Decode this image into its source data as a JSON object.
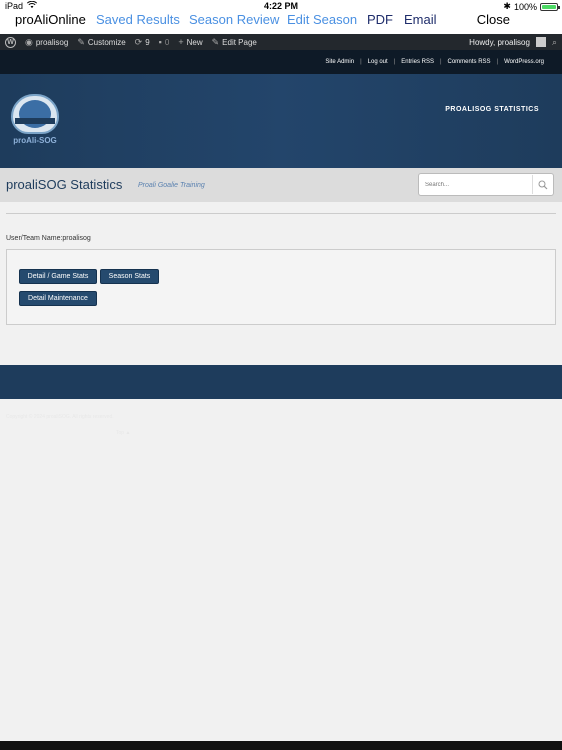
{
  "status_bar": {
    "device": "iPad",
    "time": "4:22 PM",
    "battery_percent": "100%",
    "battery_level": 1.0
  },
  "app_nav": {
    "title": "proAliOnline",
    "links": [
      "Saved Results",
      "Season Review",
      "Edit Season",
      "PDF",
      "Email"
    ],
    "close_label": "Close"
  },
  "wp_admin": {
    "site": "proalisog",
    "customize": "Customize",
    "updates": "9",
    "comments": "0",
    "new": "New",
    "edit_page": "Edit Page",
    "greeting": "Howdy, proalisog"
  },
  "top_links": [
    "Site Admin",
    "Log out",
    "Entries RSS",
    "Comments RSS",
    "WordPress.org"
  ],
  "header": {
    "logo_text": "proAli-SOG",
    "logo_badge_text": "PROALI GOALIE TRAINING",
    "right_tagline": "PROALISOG STATISTICS"
  },
  "title_bar": {
    "title": "proaliSOG Statistics",
    "subtitle": "Proali Goalie Training",
    "search_placeholder": "Search..."
  },
  "user_team": "User/Team Name:proalisog",
  "buttons": {
    "detail_game": "Detail / Game Stats",
    "season": "Season Stats",
    "maintenance": "Detail Maintenance"
  },
  "footer": {
    "credit": "Copyright © 2024 proaliSOG. All rights reserved.",
    "top": "Top ▲"
  }
}
